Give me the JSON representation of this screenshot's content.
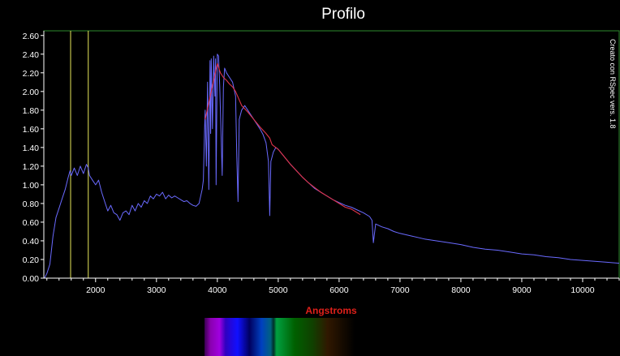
{
  "chart_data": {
    "type": "line",
    "title": "Profilo",
    "xlabel": "Angstroms",
    "ylabel": "",
    "xlim": [
      1150,
      10600
    ],
    "ylim": [
      0,
      2.65
    ],
    "x_ticks": [
      2000,
      3000,
      4000,
      5000,
      6000,
      7000,
      8000,
      9000,
      10000
    ],
    "y_ticks": [
      "0.00",
      "0.20",
      "0.40",
      "0.60",
      "0.80",
      "1.00",
      "1.20",
      "1.40",
      "1.60",
      "1.80",
      "2.00",
      "2.20",
      "2.40",
      "2.60"
    ],
    "watermark": "Creato con RSpec vers. 1.8",
    "grid": false,
    "colors": {
      "plot_border": "#2e8b2e",
      "spectrum": "#6a6aff",
      "reference": "#e0334a",
      "markers": "#e8e85a",
      "axis": "#ffffff"
    },
    "markers_x": [
      1590,
      1880
    ],
    "series": [
      {
        "color": "#6a6aff",
        "x": [
          1160,
          1200,
          1250,
          1300,
          1350,
          1400,
          1450,
          1500,
          1550,
          1580,
          1600,
          1650,
          1700,
          1750,
          1800,
          1850,
          1880,
          1900,
          1950,
          2000,
          2050,
          2100,
          2150,
          2200,
          2250,
          2300,
          2350,
          2400,
          2450,
          2500,
          2550,
          2600,
          2650,
          2700,
          2750,
          2800,
          2850,
          2900,
          2950,
          3000,
          3050,
          3100,
          3150,
          3200,
          3250,
          3300,
          3350,
          3400,
          3450,
          3500,
          3550,
          3600,
          3650,
          3700,
          3750,
          3770,
          3790,
          3800,
          3820,
          3840,
          3860,
          3880,
          3890,
          3900,
          3920,
          3940,
          3960,
          3970,
          3980,
          4000,
          4020,
          4040,
          4080,
          4100,
          4120,
          4150,
          4200,
          4250,
          4300,
          4320,
          4340,
          4360,
          4400,
          4450,
          4500,
          4550,
          4600,
          4650,
          4700,
          4750,
          4800,
          4840,
          4861,
          4880,
          4920,
          4960,
          5000,
          5100,
          5200,
          5300,
          5400,
          5500,
          5600,
          5700,
          5800,
          5900,
          6000,
          6100,
          6200,
          6300,
          6400,
          6500,
          6540,
          6563,
          6600,
          6700,
          6800,
          6900,
          7000,
          7200,
          7400,
          7600,
          7800,
          8000,
          8200,
          8400,
          8600,
          8800,
          9000,
          9200,
          9400,
          9600,
          9800,
          10000,
          10200,
          10400,
          10600
        ],
        "y": [
          0.0,
          0.05,
          0.15,
          0.45,
          0.65,
          0.75,
          0.85,
          0.95,
          1.08,
          1.15,
          1.1,
          1.18,
          1.1,
          1.2,
          1.12,
          1.22,
          1.18,
          1.1,
          1.05,
          1.0,
          1.05,
          0.92,
          0.82,
          0.72,
          0.78,
          0.7,
          0.68,
          0.62,
          0.7,
          0.72,
          0.68,
          0.78,
          0.72,
          0.8,
          0.76,
          0.83,
          0.8,
          0.88,
          0.85,
          0.9,
          0.88,
          0.92,
          0.85,
          0.89,
          0.86,
          0.88,
          0.86,
          0.84,
          0.82,
          0.83,
          0.8,
          0.78,
          0.77,
          0.8,
          0.95,
          1.05,
          1.6,
          1.8,
          1.2,
          2.1,
          0.95,
          2.33,
          1.55,
          2.35,
          1.6,
          2.38,
          1.95,
          2.35,
          1.0,
          2.4,
          2.38,
          2.05,
          1.1,
          2.05,
          2.25,
          2.2,
          2.15,
          2.1,
          1.95,
          1.3,
          0.82,
          1.7,
          1.8,
          1.85,
          1.8,
          1.75,
          1.7,
          1.65,
          1.6,
          1.54,
          1.45,
          1.25,
          0.67,
          1.25,
          1.35,
          1.4,
          1.38,
          1.3,
          1.22,
          1.15,
          1.08,
          1.02,
          0.96,
          0.92,
          0.88,
          0.84,
          0.81,
          0.78,
          0.76,
          0.73,
          0.7,
          0.66,
          0.62,
          0.38,
          0.58,
          0.55,
          0.53,
          0.5,
          0.48,
          0.45,
          0.42,
          0.4,
          0.38,
          0.36,
          0.33,
          0.31,
          0.3,
          0.28,
          0.26,
          0.25,
          0.23,
          0.22,
          0.2,
          0.19,
          0.18,
          0.17,
          0.16
        ]
      },
      {
        "color": "#e0334a",
        "x": [
          3800,
          3850,
          3900,
          3950,
          4000,
          4050,
          4100,
          4150,
          4200,
          4250,
          4300,
          4400,
          4500,
          4600,
          4700,
          4800,
          4861,
          4900,
          5000,
          5100,
          5200,
          5300,
          5400,
          5500,
          5600,
          5700,
          5800,
          5900,
          6000,
          6100,
          6200,
          6300,
          6350
        ],
        "y": [
          1.7,
          1.85,
          2.0,
          2.15,
          2.3,
          2.2,
          2.15,
          2.12,
          2.08,
          2.05,
          2.0,
          1.85,
          1.78,
          1.7,
          1.62,
          1.55,
          1.5,
          1.43,
          1.38,
          1.3,
          1.22,
          1.15,
          1.08,
          1.02,
          0.97,
          0.92,
          0.88,
          0.84,
          0.8,
          0.76,
          0.74,
          0.7,
          0.68
        ]
      }
    ]
  }
}
